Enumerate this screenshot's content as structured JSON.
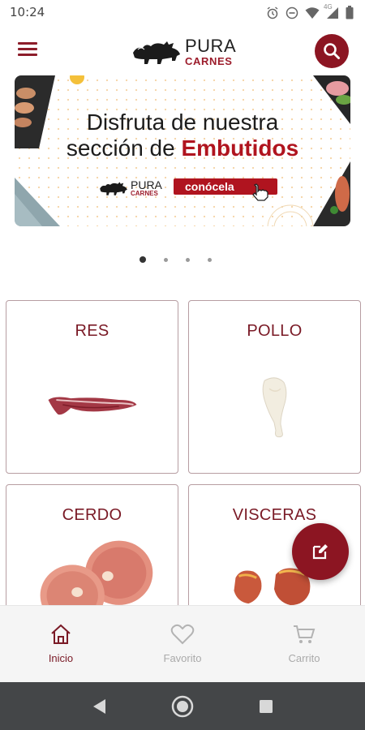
{
  "status_bar": {
    "time": "10:24",
    "network": "4G",
    "icons": [
      "alarm-icon",
      "dnd-icon",
      "wifi-icon",
      "signal-icon",
      "battery-icon"
    ]
  },
  "app_bar": {
    "brand_top": "PURA",
    "brand_bottom": "CARNES",
    "menu_icon": "hamburger-icon",
    "search_icon": "search-icon"
  },
  "banner": {
    "line1": "Disfruta de nuestra",
    "line2_prefix": "sección de ",
    "line2_highlight": "Embutidos",
    "logo_top": "PURA",
    "logo_bottom": "CARNES",
    "cta": "conócela"
  },
  "carousel": {
    "count": 4,
    "active": 1
  },
  "categories": [
    {
      "label": "RES"
    },
    {
      "label": "POLLO"
    },
    {
      "label": "CERDO"
    },
    {
      "label": "VISCERAS"
    }
  ],
  "fab": {
    "icon": "edit-icon"
  },
  "bottom_nav": {
    "items": [
      {
        "label": "Inicio",
        "icon": "home-icon",
        "active": true
      },
      {
        "label": "Favorito",
        "icon": "heart-icon",
        "active": false
      },
      {
        "label": "Carrito",
        "icon": "cart-icon",
        "active": false
      }
    ]
  },
  "system_nav": [
    "back-icon",
    "home-circle-icon",
    "recents-icon"
  ],
  "colors": {
    "brand": "#8c1522",
    "accent_red": "#b0141f",
    "card_border": "#b79da2",
    "nav_active": "#7a1a26"
  }
}
